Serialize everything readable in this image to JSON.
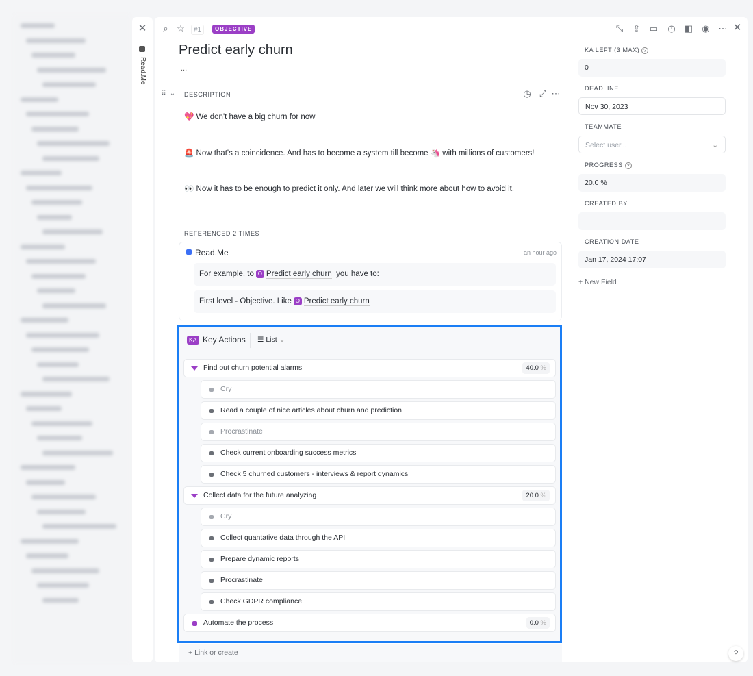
{
  "sidebar_tab": "Read.Me",
  "header": {
    "item_number": "#1",
    "type_badge": "OBJECTIVE",
    "title": "Predict early churn",
    "subtitle": "..."
  },
  "description": {
    "label": "DESCRIPTION",
    "paragraphs": [
      "💖 We don't have a big churn for now",
      "🚨 Now that's a coincidence. And has to become a system till become 🦄 with millions of customers!",
      "👀 Now it has to be enough to predict it only. And later we will think more about how to avoid it."
    ]
  },
  "references": {
    "label": "REFERENCED 2 TIMES",
    "source": "Read.Me",
    "time": "an hour ago",
    "quotes": [
      {
        "before": "For example, to",
        "link": "Predict early churn",
        "after": "you have to:"
      },
      {
        "before": "First level - Objective. Like",
        "link": "Predict early churn",
        "after": ""
      }
    ],
    "link_badge": "O"
  },
  "key_actions": {
    "badge": "KA",
    "title": "Key Actions",
    "view": "List",
    "groups": [
      {
        "label": "Find out churn potential alarms",
        "progress": "40.0",
        "children": [
          {
            "label": "Cry",
            "muted": true
          },
          {
            "label": "Read a couple of nice articles about churn and prediction"
          },
          {
            "label": "Procrastinate",
            "muted": true
          },
          {
            "label": "Check current onboarding success metrics"
          },
          {
            "label": "Check 5 churned customers - interviews & report dynamics"
          }
        ]
      },
      {
        "label": "Collect data for the future analyzing",
        "progress": "20.0",
        "children": [
          {
            "label": "Cry",
            "muted": true
          },
          {
            "label": "Collect quantative data through the API"
          },
          {
            "label": "Prepare dynamic reports"
          },
          {
            "label": "Procrastinate"
          },
          {
            "label": "Check GDPR compliance"
          }
        ]
      },
      {
        "label": "Automate the process",
        "progress": "0.0",
        "children": []
      }
    ],
    "percent_sign": "%",
    "link_or_create": "Link or create"
  },
  "fields": [
    {
      "label": "KA LEFT (3 MAX)",
      "value": "0",
      "help": true
    },
    {
      "label": "DEADLINE",
      "value": "Nov 30, 2023",
      "outlined": true
    },
    {
      "label": "TEAMMATE",
      "placeholder": "Select user...",
      "outlined": true,
      "dropdown": true
    },
    {
      "label": "PROGRESS",
      "value": "20.0 %",
      "help": true
    },
    {
      "label": "CREATED BY",
      "value": ""
    },
    {
      "label": "CREATION DATE",
      "value": "Jan 17, 2024 17:07"
    }
  ],
  "new_field": "New Field",
  "help_button": "?",
  "colors": {
    "accent": "#9b3fc6",
    "highlight": "#1a7ef5"
  }
}
